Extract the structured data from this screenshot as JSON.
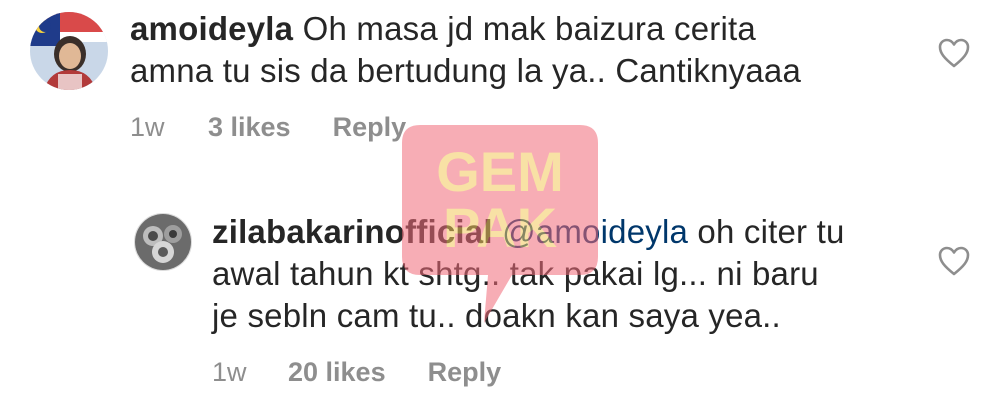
{
  "comments": [
    {
      "username": "amoideyla",
      "mention": "",
      "text_line1": "Oh masa jd mak baizura cerita",
      "text_line2": "amna tu sis da bertudung la ya.. Cantiknyaaa",
      "text_line3": "",
      "time": "1w",
      "likes": "3 likes",
      "reply": "Reply"
    },
    {
      "username": "zilabakarinofficial",
      "mention": "@amoideyla",
      "text_line1": "oh citer tu",
      "text_line2": "awal tahun kt shtg.. tak pakai lg... ni baru",
      "text_line3": "je sebln cam tu.. doakn kan saya yea..",
      "time": "1w",
      "likes": "20 likes",
      "reply": "Reply"
    }
  ],
  "watermark": {
    "line1": "GEM",
    "line2": "PAK"
  },
  "colors": {
    "username": "#262626",
    "mention": "#00376b",
    "meta": "#8e8e8e",
    "watermark_bg": "#f26b7a",
    "watermark_text": "#f4c95d"
  },
  "icons": {
    "like": "heart-outline-icon"
  }
}
